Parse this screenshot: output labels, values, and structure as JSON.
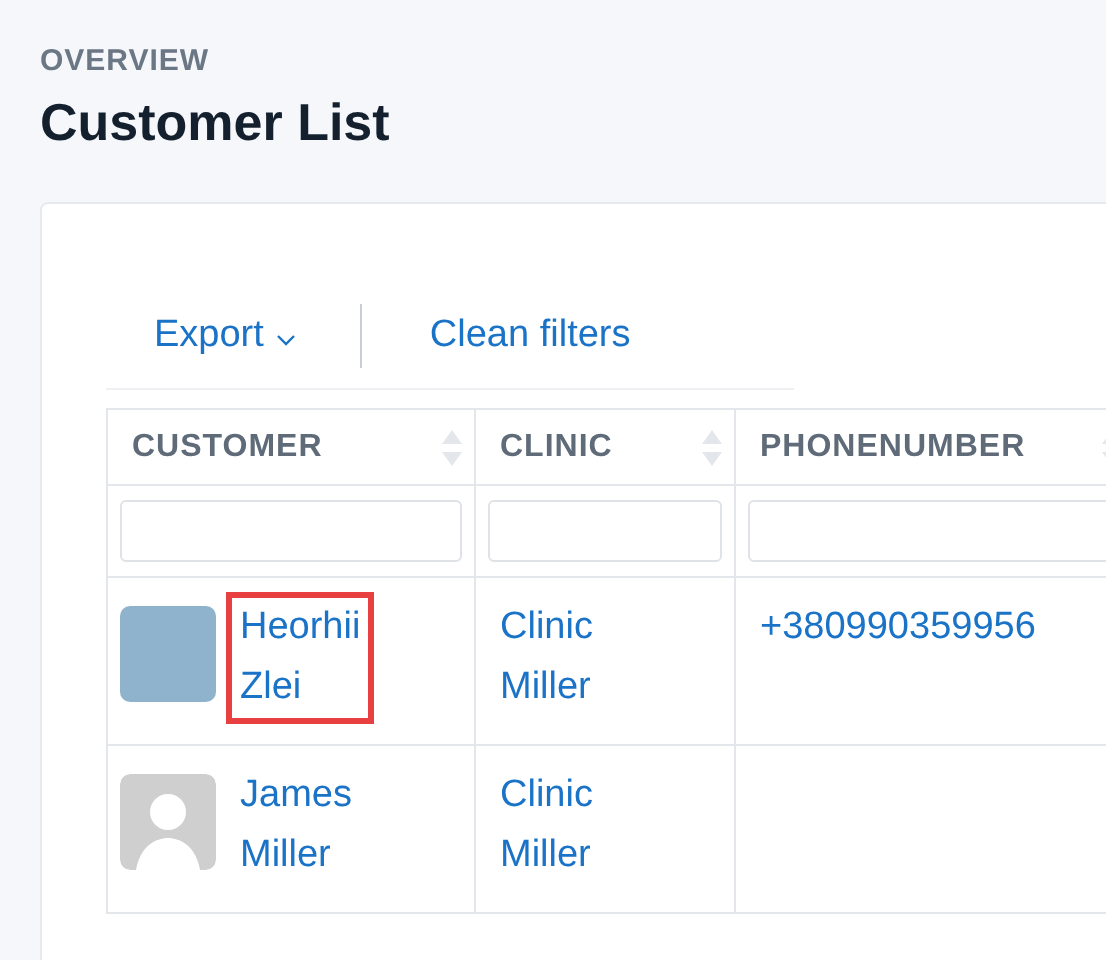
{
  "breadcrumb": "OVERVIEW",
  "title": "Customer List",
  "toolbar": {
    "export": "Export",
    "clean_filters": "Clean filters"
  },
  "table": {
    "columns": [
      {
        "label": "CUSTOMER"
      },
      {
        "label": "CLINIC"
      },
      {
        "label": "PHONENUMBER"
      }
    ],
    "rows": [
      {
        "kind": "photo",
        "name": "Heorhii Zlei",
        "highlighted": true,
        "clinic": "Clinic Miller",
        "phone": "+380990359956"
      },
      {
        "kind": "placeholder",
        "name": "James Miller",
        "highlighted": false,
        "clinic": "Clinic Miller",
        "phone": ""
      }
    ]
  }
}
